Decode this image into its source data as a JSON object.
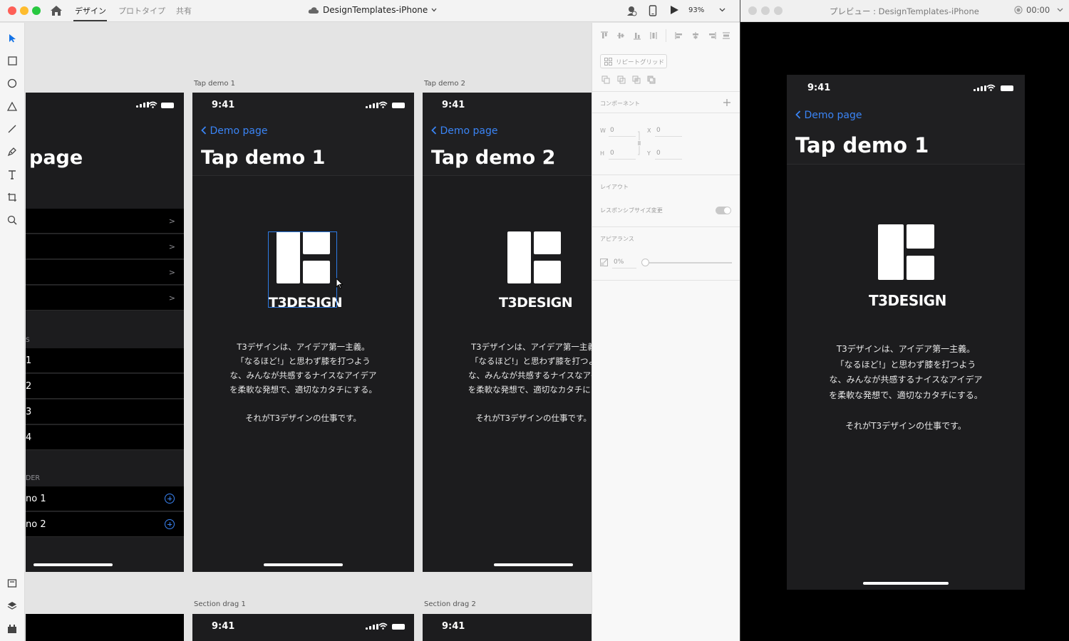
{
  "xd": {
    "tabs": [
      "デザイン",
      "プロトタイプ",
      "共有"
    ],
    "active_tab": 0,
    "document_title": "DesignTemplates-iPhone",
    "zoom": "93%"
  },
  "artboards": {
    "partial": {
      "title": "page",
      "section_header_1": "S",
      "numbered_rows": [
        "1",
        "2",
        "3",
        "4"
      ],
      "section_header_2": "DER",
      "demo_rows": [
        "no 1",
        "no 2"
      ]
    },
    "tap_demo_1": {
      "label": "Tap demo 1",
      "time": "9:41",
      "back": "Demo page",
      "title": "Tap demo 1",
      "logo_text": "T3DESIGN",
      "body": "T3デザインは、アイデア第一主義。\n「なるほど!」と思わず膝を打つよう\nな、みんなが共感するナイスなアイデア\nを柔軟な発想で、適切なカタチにする。\n\nそれがT3デザインの仕事です。"
    },
    "tap_demo_2": {
      "label": "Tap demo 2",
      "time": "9:41",
      "back": "Demo page",
      "title": "Tap demo 2",
      "logo_text": "T3DESIGN",
      "body": "T3デザインは、アイデア第一主義\n「なるほど!」と思わず膝を打つよ\nな、みんなが共感するナイスなアイ\nを柔軟な発想で、適切なカタチにす\n\nそれがT3デザインの仕事です。"
    },
    "section_drag_1": {
      "label": "Section drag 1",
      "time": "9:41"
    },
    "section_drag_2": {
      "label": "Section drag 2",
      "time": "9:41"
    }
  },
  "inspector": {
    "repeat_grid": "リピートグリッド",
    "component": "コンポーネント",
    "w_label": "W",
    "w_value": "0",
    "x_label": "X",
    "x_value": "0",
    "h_label": "H",
    "h_value": "0",
    "y_label": "Y",
    "y_value": "0",
    "layout": "レイアウト",
    "responsive_resize": "レスポンシブサイズ変更",
    "responsive_on": true,
    "appearance": "アピアランス",
    "opacity": "0%"
  },
  "preview": {
    "window_title": "プレビュー : DesignTemplates-iPhone",
    "timer": "00:00",
    "time": "9:41",
    "back": "Demo page",
    "title": "Tap demo 1",
    "logo_text": "T3DESIGN",
    "body": "T3デザインは、アイデア第一主義。\n「なるほど!」と思わず膝を打つよう\nな、みんなが共感するナイスなアイデア\nを柔軟な発想で、適切なカタチにする。\n\nそれがT3デザインの仕事です。"
  }
}
